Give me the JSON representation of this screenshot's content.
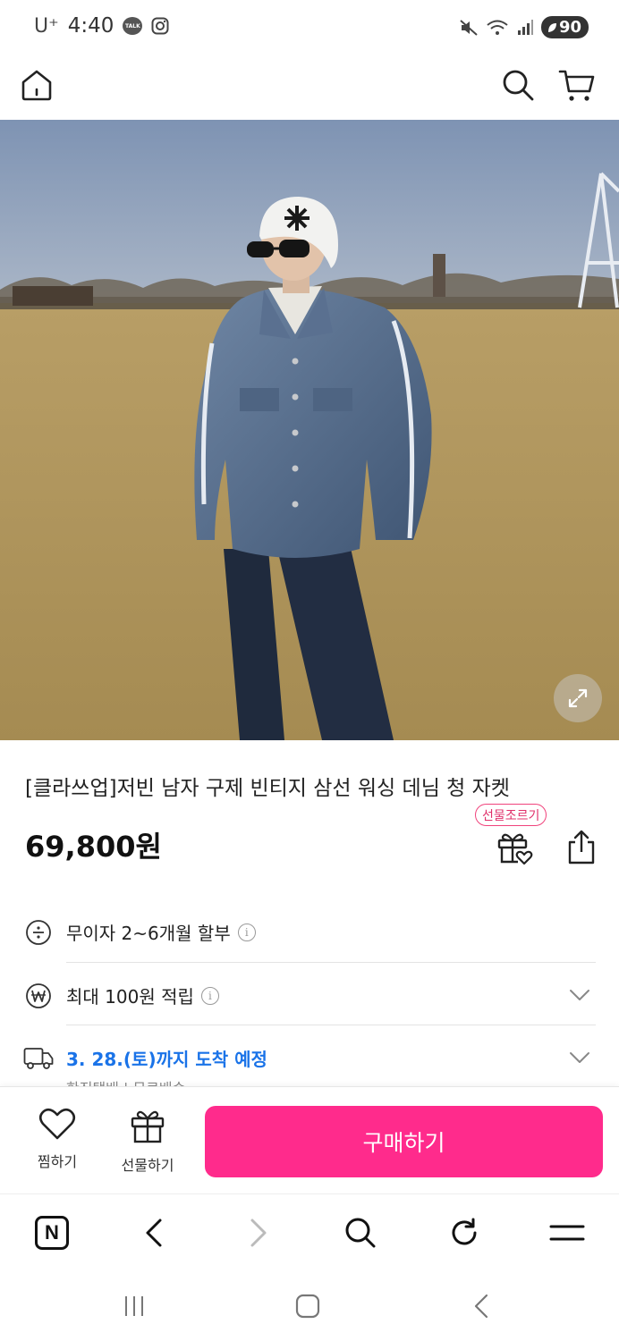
{
  "status_bar": {
    "carrier": "U⁺",
    "time": "4:40",
    "talk_badge": "TALK",
    "battery": "90",
    "icons": [
      "talk-icon",
      "instagram-icon",
      "mute-icon",
      "wifi-icon",
      "signal-icon",
      "battery-icon"
    ]
  },
  "header": {
    "icons": [
      "home-icon",
      "search-icon",
      "cart-icon"
    ]
  },
  "hero_image": {
    "description_icon": "expand-icon"
  },
  "product": {
    "title": "[클라쓰업]저빈 남자 구제 빈티지 삼선 워싱 데님 청 자켓",
    "price": "69,800원",
    "gift_request_label": "선물조르기"
  },
  "info_rows": {
    "installment": "무이자 2~6개월 할부",
    "points": "최대 100원 적립",
    "delivery": "3. 28.(토)까지 도착 예정",
    "delivery_sub": "한진택배 | 무료배송"
  },
  "purchase_bar": {
    "wish_label": "찜하기",
    "gift_label": "선물하기",
    "buy_label": "구매하기"
  },
  "browser_bar": {
    "naver_letter": "N"
  },
  "colors": {
    "accent_pink": "#ff2b8c",
    "delivery_blue": "#1a73e8"
  }
}
